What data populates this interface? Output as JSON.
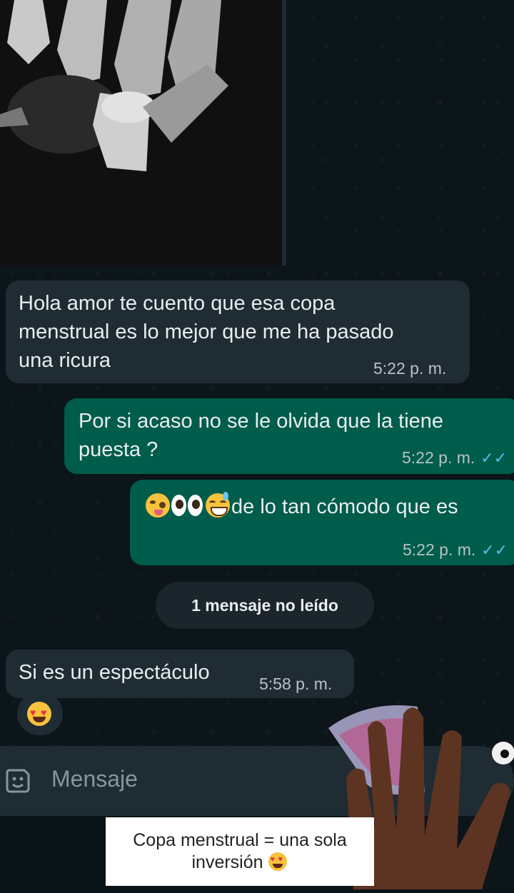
{
  "messages": [
    {
      "direction": "in",
      "text_lines": [
        "Hola amor te cuento que esa copa",
        "menstrual es lo mejor que me ha pasado",
        "una ricura"
      ],
      "time": "5:22 p. m."
    },
    {
      "direction": "out",
      "text_lines": [
        "Por si acaso no se le olvida que la tiene",
        "puesta ?"
      ],
      "time": "5:22 p. m.",
      "status": "read"
    },
    {
      "direction": "out",
      "text": "de lo tan cómodo que es",
      "emojis": [
        "woozy-face-emoji",
        "eyes-emoji",
        "grinning-sweat-emoji"
      ],
      "time": "5:22 p. m.",
      "status": "read"
    },
    {
      "direction": "in",
      "text": "Si es un espectáculo",
      "time": "5:58 p. m."
    }
  ],
  "unread_divider": "1 mensaje no leído",
  "reaction": "heart-eyes-emoji",
  "composer": {
    "placeholder": "Mensaje"
  },
  "overlay_caption": {
    "line1": "Copa menstrual  = una sola",
    "line2": "inversión"
  },
  "colors": {
    "incoming_bubble": "#1f2c33",
    "outgoing_bubble": "#005c4b",
    "read_ticks": "#53bdeb",
    "background": "#0c1519"
  }
}
